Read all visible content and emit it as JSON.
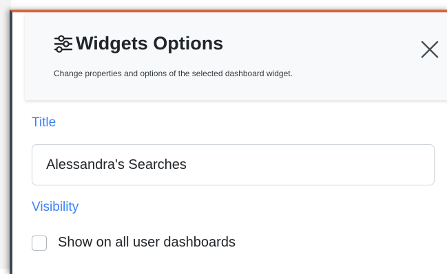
{
  "header": {
    "title": "Widgets Options",
    "subtitle": "Change properties and options of the selected dashboard widget.",
    "icon": "sliders-icon",
    "close_icon": "close-icon"
  },
  "form": {
    "title_label": "Title",
    "title_value": "Alessandra's Searches",
    "visibility_label": "Visibility",
    "show_all_label": "Show on all user dashboards",
    "show_all_checked": false
  },
  "colors": {
    "accent_top": "#d9643a",
    "panel_border": "#3a4752",
    "label_blue": "#3b82f6"
  }
}
